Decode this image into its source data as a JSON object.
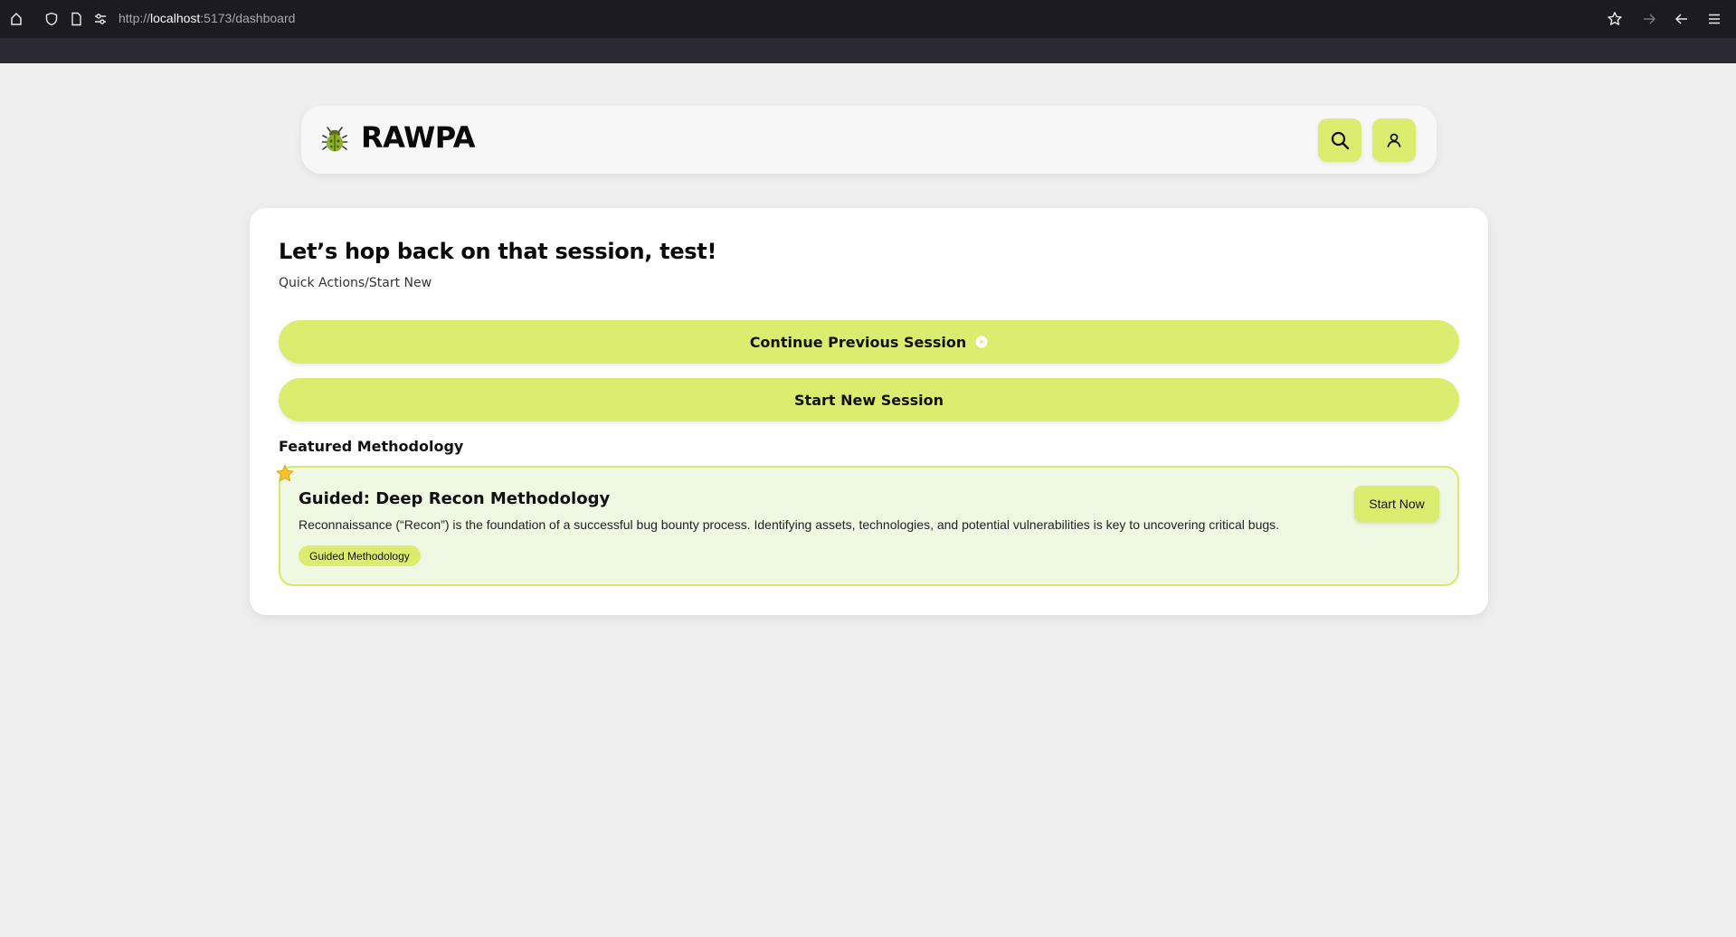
{
  "browser": {
    "url_prefix": "http://",
    "url_host": "localhost",
    "url_rest": ":5173/dashboard"
  },
  "header": {
    "brand": "RAWPA",
    "logo_icon": "bug-icon",
    "search_icon": "search-icon",
    "profile_icon": "user-icon",
    "accent_color": "#dbed6e"
  },
  "main": {
    "greeting": "Let’s hop back on that session, test!",
    "subtitle": "Quick Actions/Start New",
    "continue_label": "Continue Previous Session",
    "start_new_label": "Start New Session",
    "featured_heading": "Featured Methodology"
  },
  "featured": {
    "title": "Guided: Deep Recon Methodology",
    "description": "Reconnaissance (“Recon”) is the foundation of a successful bug bounty process. Identifying assets, technologies, and potential vulnerabilities is key to uncovering critical bugs.",
    "tag": "Guided Methodology",
    "action_label": "Start Now",
    "badge_icon": "star-icon"
  }
}
